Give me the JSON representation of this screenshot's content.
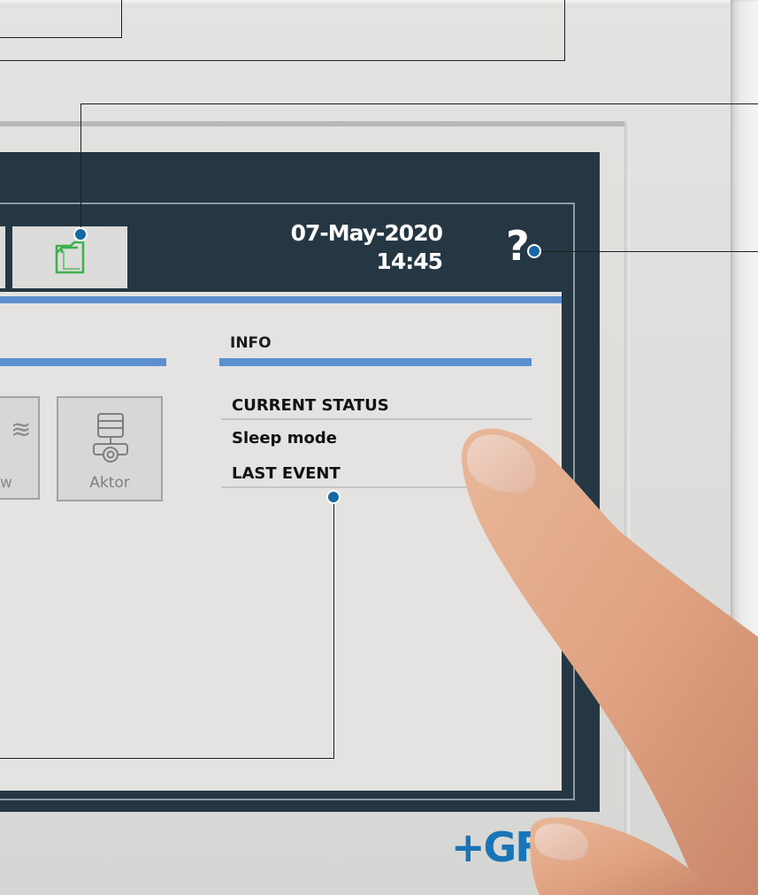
{
  "header": {
    "date": "07-May-2020",
    "time": "14:45",
    "help_label": "?"
  },
  "tabs": [
    {
      "name": "documents",
      "icon": "document-icon",
      "color": "#3cb04a"
    }
  ],
  "panel_left": {
    "tiles": [
      {
        "label": "w",
        "icon": "flow-icon"
      },
      {
        "label": "Aktor",
        "icon": "actuator-icon"
      }
    ]
  },
  "info": {
    "title": "INFO",
    "current_status_label": "CURRENT STATUS",
    "current_status_value": "Sleep mode",
    "last_event_label": "LAST EVENT"
  },
  "brand": {
    "logo_text": "+GF",
    "color": "#1a74b8"
  },
  "colors": {
    "screen_background": "#243743",
    "accent_blue": "#5b8fcf",
    "callout_dot": "#1468a6"
  }
}
